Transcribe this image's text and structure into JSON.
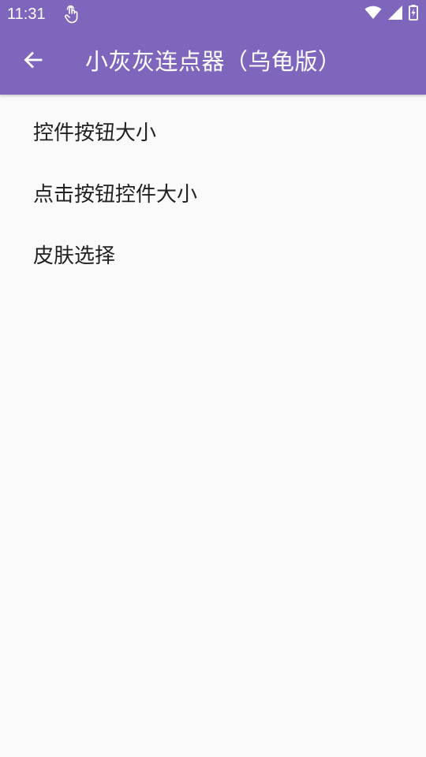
{
  "status_bar": {
    "time": "11:31",
    "icons": [
      "touch-icon",
      "wifi-icon",
      "signal-icon",
      "battery-charging-icon"
    ]
  },
  "app_bar": {
    "title": "小灰灰连点器（乌龟版）",
    "back_icon": "arrow-left-icon",
    "color": "#7e66bc"
  },
  "settings": {
    "items": [
      {
        "label": "控件按钮大小"
      },
      {
        "label": "点击按钮控件大小"
      },
      {
        "label": "皮肤选择"
      }
    ]
  },
  "colors": {
    "background": "#fafafa",
    "text_primary": "#212121",
    "on_primary": "#ffffff"
  }
}
